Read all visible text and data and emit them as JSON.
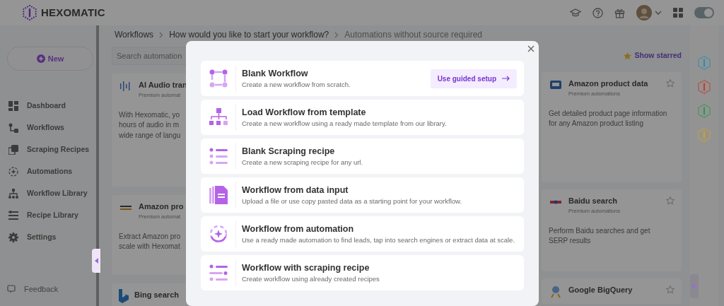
{
  "header": {
    "logo_text": "HEXOMATIC"
  },
  "sidebar": {
    "new_button": "New",
    "items": [
      {
        "label": "Dashboard"
      },
      {
        "label": "Workflows"
      },
      {
        "label": "Scraping Recipes"
      },
      {
        "label": "Automations"
      },
      {
        "label": "Workflow Library"
      },
      {
        "label": "Recipe Library"
      },
      {
        "label": "Settings"
      }
    ],
    "footer_items": [
      {
        "label": "Feedback"
      }
    ]
  },
  "breadcrumb": [
    "Workflows",
    "How would you like to start your workflow?",
    "Automations without source required"
  ],
  "search": {
    "placeholder": "Search automation"
  },
  "show_starred": "Show starred",
  "left_cards": [
    {
      "title": "AI Audio tran",
      "subtitle": "Premium automat",
      "description_lines": [
        "With Hexomatic, yo",
        "hours of audio in m",
        "wide range of langu"
      ]
    },
    {
      "title": "Amazon pro",
      "subtitle": "Premium automat",
      "description_lines": [
        "Extract Amazon pro",
        "scale with Hexomat"
      ]
    },
    {
      "title": "Bing search"
    }
  ],
  "right_cards": [
    {
      "title": "Amazon product data",
      "subtitle": "Premium automations",
      "description": "Get detailed product page information for any Amazon product listing",
      "starred": false
    },
    {
      "title": "Baidu search",
      "subtitle": "Premium automations",
      "description": "Perform Baidu searches and get SERP results",
      "starred": false
    },
    {
      "title": "Google BigQuery",
      "starred": false
    }
  ],
  "right_rail": [
    {
      "color": "#2b8fb0"
    },
    {
      "color": "#c0402e"
    },
    {
      "color": "#2f9a48"
    },
    {
      "color": "#c8a22a"
    }
  ],
  "modal": {
    "options": [
      {
        "title": "Blank Workflow",
        "description": "Create a new workflow from scratch.",
        "action": "Use guided setup"
      },
      {
        "title": "Load Workflow from template",
        "description": "Create a new workflow using a ready made template from our library."
      },
      {
        "title": "Blank Scraping recipe",
        "description": "Create a new scraping recipe for any url."
      },
      {
        "title": "Workflow from data input",
        "description": "Upload a file or use copy pasted data as a starting point for your workflow."
      },
      {
        "title": "Workflow from automation",
        "description": "Use a ready made automation to find leads, tap into search engines or extract data at scale."
      },
      {
        "title": "Workflow with scraping recipe",
        "description": "Create workflow using already created recipes"
      }
    ]
  }
}
